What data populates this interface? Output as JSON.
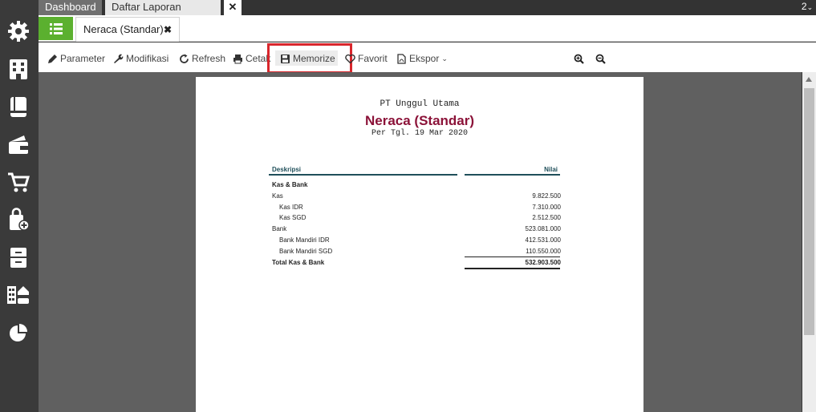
{
  "top_tabs": [
    "Dashboard",
    "Daftar Laporan"
  ],
  "top_right_label": "2",
  "doc_tab": {
    "label": "Neraca (Standar)"
  },
  "toolbar": {
    "parameter": "Parameter",
    "modifikasi": "Modifikasi",
    "refresh": "Refresh",
    "cetak": "Cetak",
    "memorize": "Memorize",
    "favorit": "Favorit",
    "ekspor": "Ekspor"
  },
  "report": {
    "company": "PT Unggul Utama",
    "title": "Neraca (Standar)",
    "date": "Per Tgl. 19 Mar 2020",
    "col_desc": "Deskripsi",
    "col_value": "Nilai",
    "rows": [
      {
        "label": "Kas & Bank",
        "value": ""
      },
      {
        "label": "Kas",
        "value": "9.822.500"
      },
      {
        "label": "Kas IDR",
        "value": "7.310.000"
      },
      {
        "label": "Kas SGD",
        "value": "2.512.500"
      },
      {
        "label": "Bank",
        "value": "523.081.000"
      },
      {
        "label": "Bank Mandiri IDR",
        "value": "412.531.000"
      },
      {
        "label": "Bank Mandiri SGD",
        "value": "110.550.000"
      },
      {
        "label": "Total Kas & Bank",
        "value": "532.903.500"
      }
    ]
  },
  "colors": {
    "accent_green": "#5bb02f",
    "title_maroon": "#8b1238",
    "highlight_red": "#d9262c"
  }
}
